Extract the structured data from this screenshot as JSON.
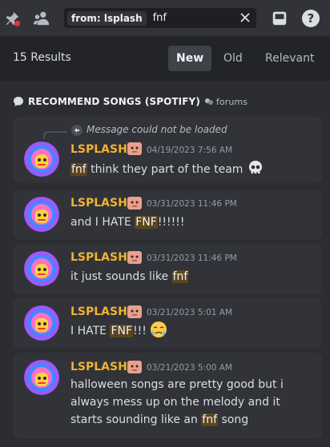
{
  "topbar": {
    "icons": [
      "pin-icon",
      "members-icon",
      "inbox-icon",
      "help-icon"
    ],
    "search": {
      "filter_chip": "from: lsplash",
      "query": "fnf"
    }
  },
  "results": {
    "count_label": "15 Results",
    "sort_tabs": [
      {
        "label": "New",
        "active": true
      },
      {
        "label": "Old",
        "active": false
      },
      {
        "label": "Relevant",
        "active": false
      }
    ]
  },
  "channel": {
    "name": "RECOMMEND SONGS (SPOTIFY)",
    "category": "forums"
  },
  "messages": [
    {
      "reply_note": "Message could not be loaded",
      "author": "LSPLASH",
      "timestamp": "04/19/2023 7:56 AM",
      "parts": [
        {
          "hl": "fnf"
        },
        {
          "t": " think they part of the team "
        }
      ],
      "emoji": "skull-emoji"
    },
    {
      "author": "LSPLASH",
      "timestamp": "03/31/2023 11:46 PM",
      "parts": [
        {
          "t": "and I HATE "
        },
        {
          "hl": "FNF"
        },
        {
          "t": "!!!!!!"
        }
      ]
    },
    {
      "author": "LSPLASH",
      "timestamp": "03/31/2023 11:46 PM",
      "parts": [
        {
          "t": "it just sounds like "
        },
        {
          "hl": "fnf"
        }
      ]
    },
    {
      "author": "LSPLASH",
      "timestamp": "03/21/2023 5:01 AM",
      "parts": [
        {
          "t": "I HATE "
        },
        {
          "hl": "FNF"
        },
        {
          "t": "!!! "
        }
      ],
      "emoji": "crying-emoji"
    },
    {
      "author": "LSPLASH",
      "timestamp": "03/21/2023 5:00 AM",
      "parts": [
        {
          "t": "halloween songs are pretty good but i always mess up on the melody and it starts sounding like an "
        },
        {
          "hl": "fnf"
        },
        {
          "t": " song"
        }
      ]
    }
  ],
  "colors": {
    "username": "#f0b232",
    "highlight": "#5c4620",
    "accent_avatar": "#9b59ff"
  }
}
